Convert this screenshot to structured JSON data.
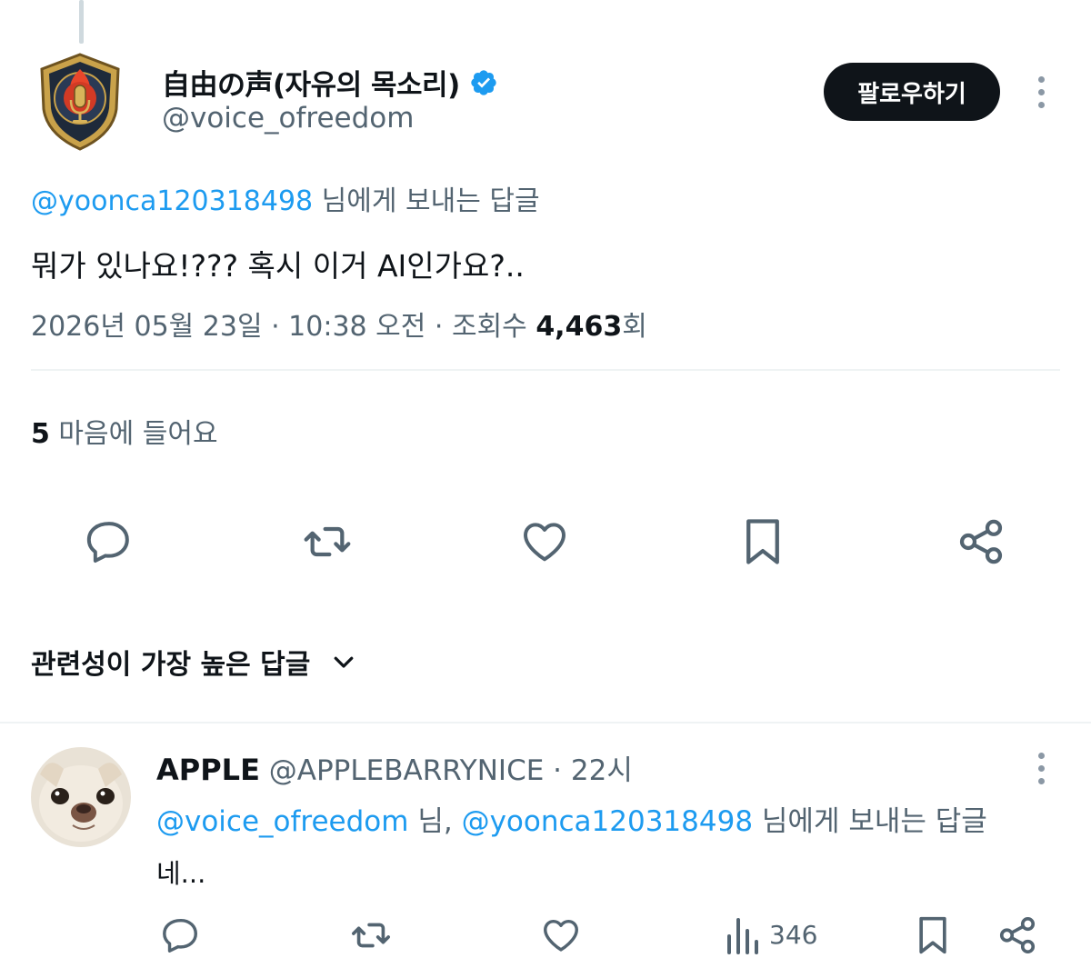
{
  "tweet": {
    "author": {
      "display_name": "自由の声(자유의 목소리)",
      "handle": "@voice_ofreedom",
      "verified": true
    },
    "follow_label": "팔로우하기",
    "reply_to": {
      "mention": "@yoonca120318498",
      "suffix": " 님에게 보내는 답글"
    },
    "text": "뭐가 있나요!??? 혹시 이거 AI인가요?..",
    "meta": {
      "datetime": "2026년 05월 23일 · 10:38 오전 · 조회수 ",
      "views": "4,463",
      "views_suffix": "회"
    },
    "likes": {
      "count": "5",
      "label": " 마음에 들어요"
    }
  },
  "sort": {
    "label": "관련성이 가장 높은 답글"
  },
  "reply": {
    "display_name": "APPLE",
    "handle": "@APPLEBARRYNICE",
    "time": " · 22시",
    "reply_to": {
      "mention1": "@voice_ofreedom",
      "mid": " 님, ",
      "mention2": "@yoonca120318498",
      "suffix": " 님에게 보내는 답글"
    },
    "text": "네...",
    "views": "346"
  },
  "colors": {
    "accent": "#1d9bf0",
    "text": "#0f1419",
    "muted": "#536471",
    "button": "#0f1419"
  },
  "icons": [
    "reply-icon",
    "retweet-icon",
    "like-icon",
    "bookmark-icon",
    "share-icon",
    "views-icon",
    "more-icon",
    "verified-icon",
    "chevron-down-icon"
  ]
}
